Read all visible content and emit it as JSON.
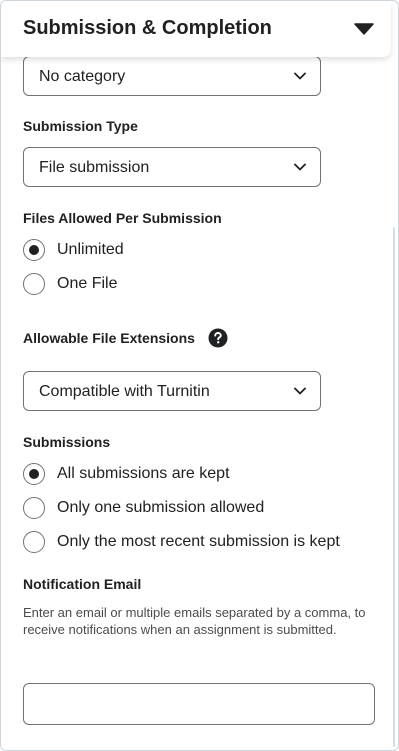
{
  "panel": {
    "title": "Submission & Completion",
    "collapse_icon": "caret-down-icon"
  },
  "category": {
    "selected": "No category"
  },
  "submission_type": {
    "label": "Submission Type",
    "selected": "File submission"
  },
  "files_allowed": {
    "label": "Files Allowed Per Submission",
    "options": [
      "Unlimited",
      "One File"
    ],
    "selected_index": 0
  },
  "file_extensions": {
    "label": "Allowable File Extensions",
    "help_icon": "question-circle-icon",
    "selected": "Compatible with Turnitin"
  },
  "submissions": {
    "label": "Submissions",
    "options": [
      "All submissions are kept",
      "Only one submission allowed",
      "Only the most recent submission is kept"
    ],
    "selected_index": 0
  },
  "notification_email": {
    "label": "Notification Email",
    "helper": "Enter an email or multiple emails separated by a comma, to receive notifications when an assignment is submitted.",
    "value": ""
  }
}
